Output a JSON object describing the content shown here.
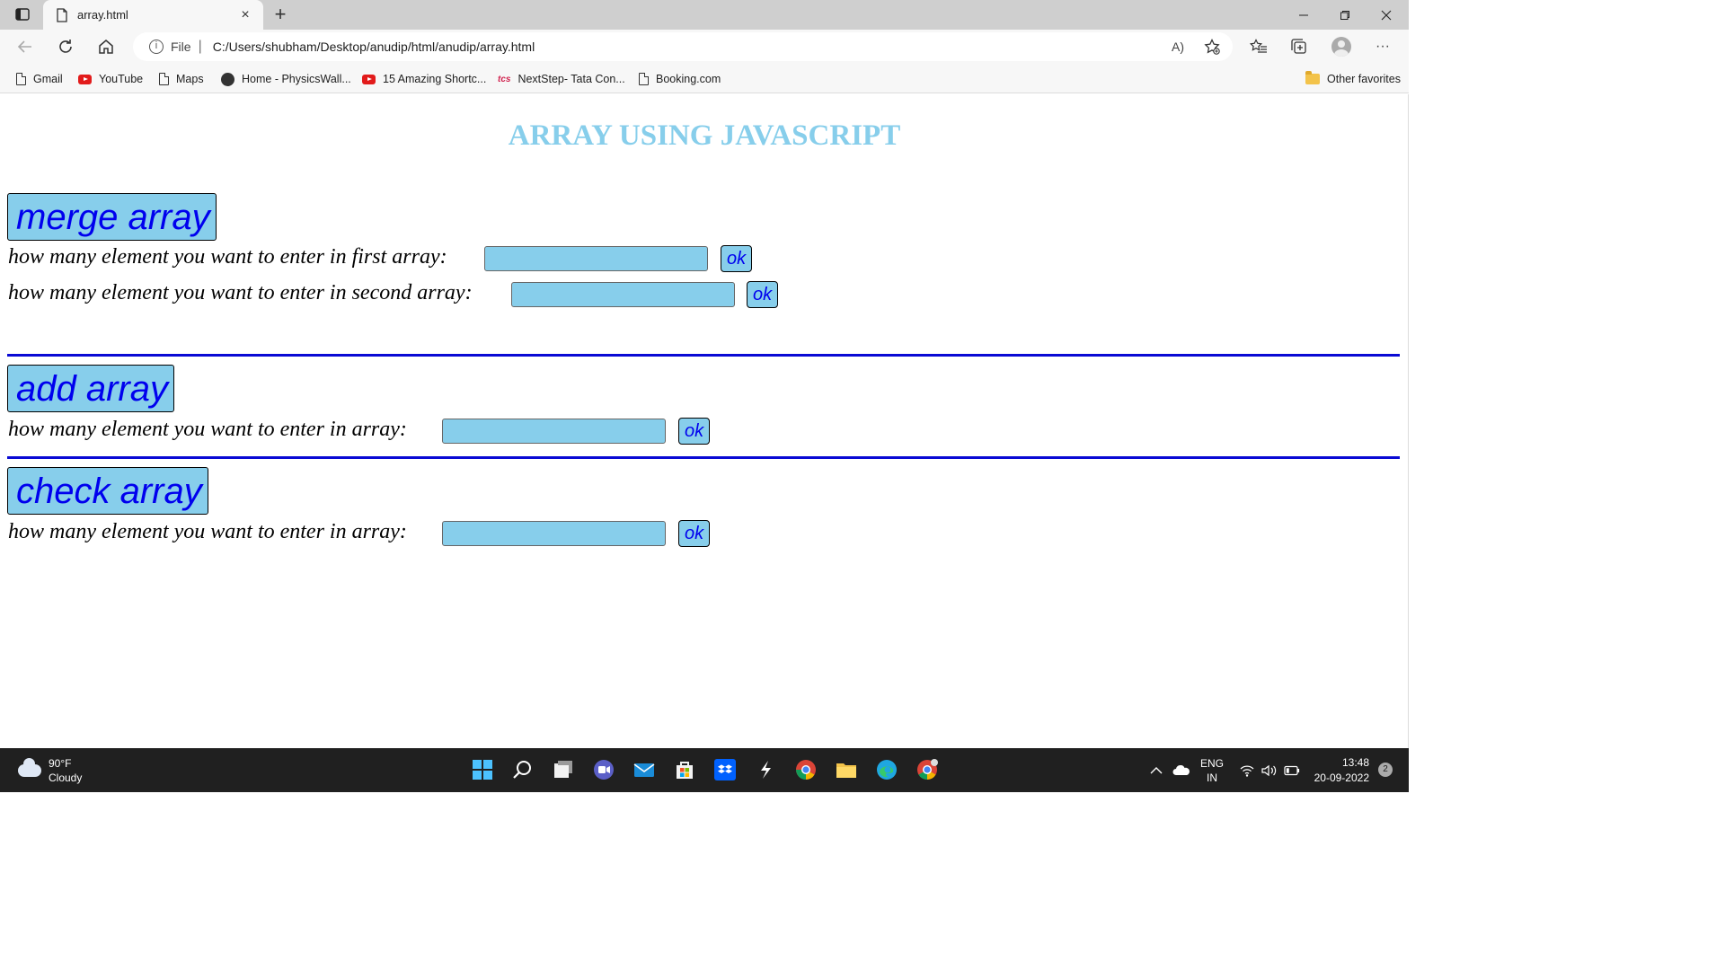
{
  "browser": {
    "tab_title": "array.html",
    "tab_close": "×",
    "new_tab": "+",
    "address_scheme": "File",
    "address_separator": "|",
    "url": "C:/Users/shubham/Desktop/anudip/html/anudip/array.html",
    "read_aloud": "A)",
    "more": "···"
  },
  "favorites": [
    {
      "label": "Gmail",
      "icon": "doc-icon"
    },
    {
      "label": "YouTube",
      "icon": "youtube-icon"
    },
    {
      "label": "Maps",
      "icon": "doc-icon"
    },
    {
      "label": "Home - PhysicsWall...",
      "icon": "physicswallah-icon"
    },
    {
      "label": "15 Amazing Shortc...",
      "icon": "youtube-icon"
    },
    {
      "label": "NextStep- Tata Con...",
      "icon": "tcs-icon"
    },
    {
      "label": "Booking.com",
      "icon": "doc-icon"
    }
  ],
  "favorites_tcs_glyph": "tcs",
  "other_favorites": "Other favorites",
  "page": {
    "title": "ARRAY USING JAVASCRIPT",
    "sections": {
      "merge": {
        "button": "merge array",
        "prompt1": "how many element you want to enter in first array:",
        "prompt2": "how many element you want to enter in second array:",
        "ok": "ok"
      },
      "add": {
        "button": "add array",
        "prompt": "how many element you want to enter in array:",
        "ok": "ok"
      },
      "check": {
        "button": "check array",
        "prompt": "how many element you want to enter in array:",
        "ok": "ok"
      }
    }
  },
  "taskbar": {
    "temperature": "90°F",
    "condition": "Cloudy",
    "lang_top": "ENG",
    "lang_bottom": "IN",
    "time": "13:48",
    "date": "20-09-2022",
    "notifications": "2"
  },
  "colors": {
    "page_title": "#87ceeb",
    "button_fill": "#87ceeb",
    "button_text": "#0000ee",
    "divider": "#0a0ad4"
  }
}
